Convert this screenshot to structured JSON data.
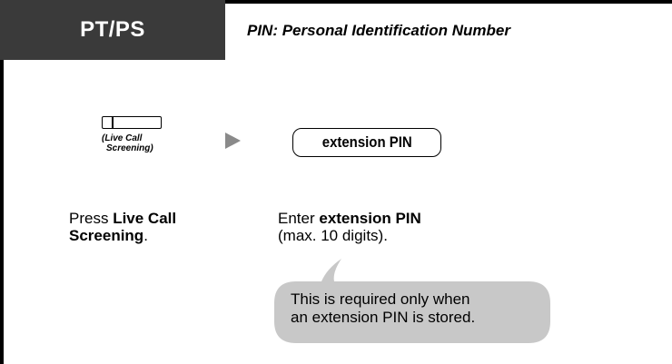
{
  "header": {
    "tab_label": "PT/PS",
    "subtitle": "PIN: Personal Identification Number",
    "tab_color": "#3a3a3a"
  },
  "step1": {
    "key_caption_line1": "(Live Call",
    "key_caption_line2": "Screening)",
    "instruction_prefix": "Press ",
    "instruction_bold_1": "Live Call",
    "instruction_bold_2": "Screening",
    "instruction_suffix": "."
  },
  "step2": {
    "pin_box_label": "extension PIN",
    "instruction_prefix": "Enter ",
    "instruction_bold": "extension PIN",
    "instruction_detail": "(max. 10 digits)."
  },
  "note": {
    "line1": "This is required only when",
    "line2": "an extension PIN is stored.",
    "bubble_color": "#c8c8c8"
  },
  "icons": {
    "arrow": "right-triangle-arrow",
    "arrow_color": "#8a8a8a"
  }
}
